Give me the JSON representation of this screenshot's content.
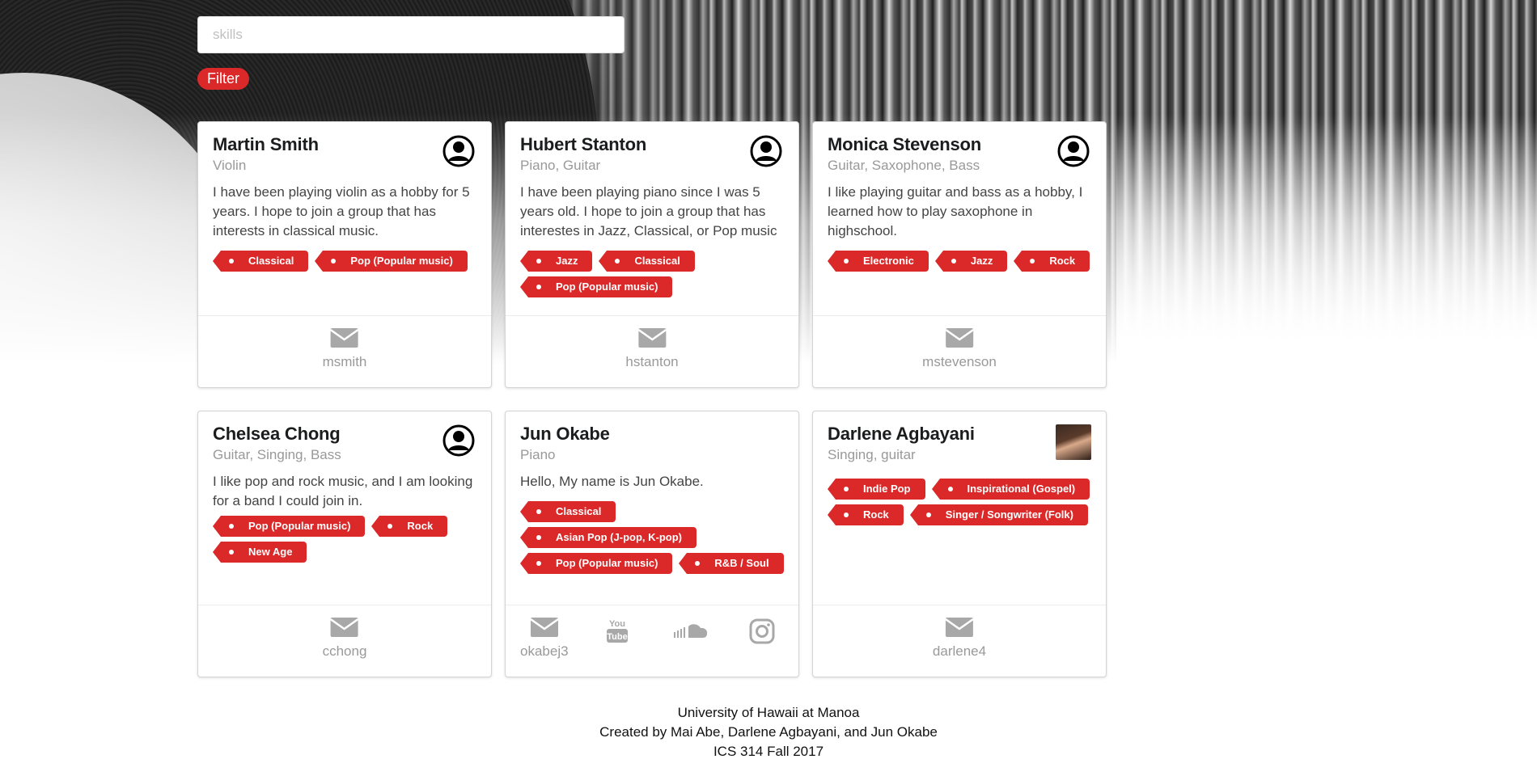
{
  "filter": {
    "placeholder": "skills",
    "button_label": "Filter"
  },
  "colors": {
    "accent": "#db2828",
    "muted": "#999999"
  },
  "profiles": [
    {
      "name": "Martin Smith",
      "instruments": "Violin",
      "description": "I have been playing violin as a hobby for 5 years. I hope to join a group that has interests in classical music.",
      "avatar": "user-circle-icon",
      "tags": [
        "Classical",
        "Pop (Popular music)"
      ],
      "username": "msmith"
    },
    {
      "name": "Hubert Stanton",
      "instruments": "Piano, Guitar",
      "description": "I have been playing piano since I was 5 years old. I hope to join a group that has interestes in Jazz, Classical, or Pop music",
      "avatar": "user-circle-icon",
      "tags": [
        "Jazz",
        "Classical",
        "Pop (Popular music)"
      ],
      "username": "hstanton"
    },
    {
      "name": "Monica Stevenson",
      "instruments": "Guitar, Saxophone, Bass",
      "description": "I like playing guitar and bass as a hobby, I learned how to play saxophone in highschool.",
      "avatar": "user-circle-icon",
      "tags": [
        "Electronic",
        "Jazz",
        "Rock"
      ],
      "username": "mstevenson"
    },
    {
      "name": "Chelsea Chong",
      "instruments": "Guitar, Singing, Bass",
      "description": "I like pop and rock music, and I am looking for a band I could join in.",
      "avatar": "user-circle-icon",
      "tags": [
        "Pop (Popular music)",
        "Rock",
        "New Age"
      ],
      "username": "cchong"
    },
    {
      "name": "Jun Okabe",
      "instruments": "Piano",
      "description": "Hello, My name is Jun Okabe.",
      "tags": [
        "Classical",
        "Asian Pop (J-pop, K-pop)",
        "Pop (Popular music)",
        "R&B / Soul"
      ],
      "username": "okabej3",
      "socials": [
        "youtube-icon",
        "soundcloud-icon",
        "instagram-icon"
      ]
    },
    {
      "name": "Darlene Agbayani",
      "instruments": "Singing, guitar",
      "description": "",
      "avatar": "profile-photo",
      "tags": [
        "Indie Pop",
        "Inspirational (Gospel)",
        "Rock",
        "Singer / Songwriter (Folk)"
      ],
      "username": "darlene4"
    }
  ],
  "footer": {
    "line1": "University of Hawaii at Manoa",
    "line2": "Created by Mai Abe, Darlene Agbayani, and Jun Okabe",
    "line3": "ICS 314 Fall 2017"
  }
}
